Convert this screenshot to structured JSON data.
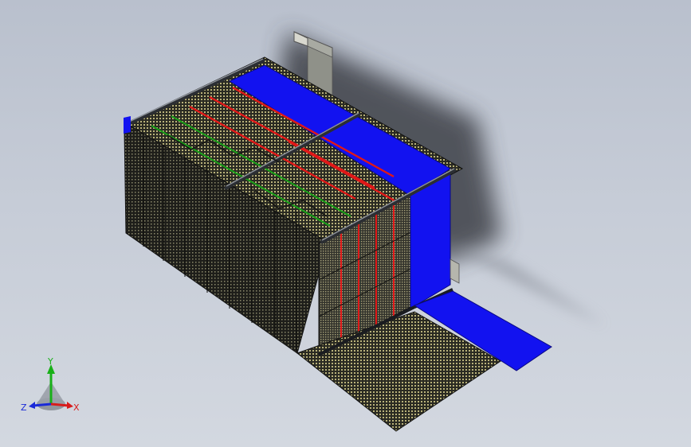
{
  "viewport": {
    "background_top": "#b9c0cd",
    "background_bottom": "#d3d8e0"
  },
  "model": {
    "colors": {
      "mesh_dark": "#2a2a22",
      "mesh_light": "#b9b27a",
      "accent_blue": "#1212f0",
      "rail_red": "#e01818",
      "rail_green": "#18a018",
      "frame_gray": "#8f949b",
      "bracket_gray": "#a8aaa2",
      "shadow": "#3c3f47"
    }
  },
  "triad": {
    "x_label": "X",
    "y_label": "Y",
    "z_label": "Z",
    "x_color": "#d81c1c",
    "y_color": "#18b018",
    "z_color": "#1a2ad8"
  }
}
